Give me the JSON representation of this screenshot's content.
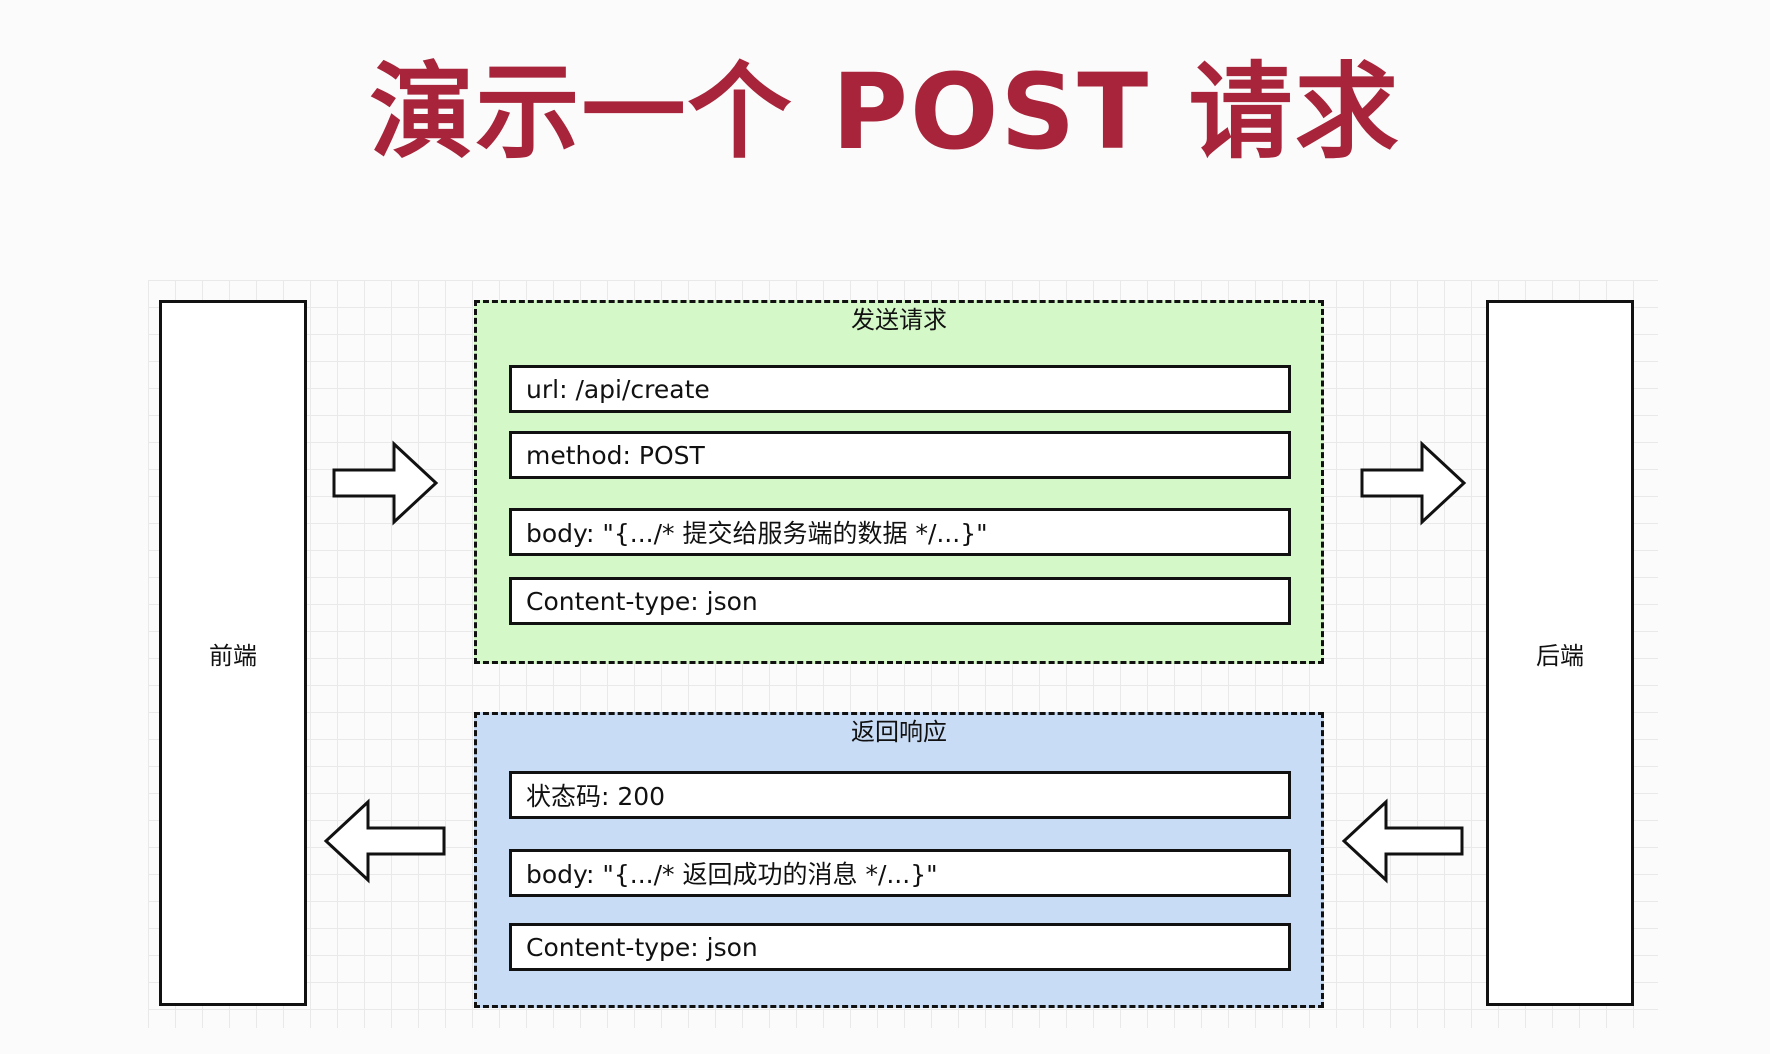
{
  "title": "演示一个 POST 请求",
  "frontend_label": "前端",
  "backend_label": "后端",
  "request": {
    "title": "发送请求",
    "fields": [
      "url: /api/create",
      "method: POST",
      "body: \"{.../* 提交给服务端的数据 */...}\"",
      "Content-type: json"
    ]
  },
  "response": {
    "title": "返回响应",
    "fields": [
      "状态码: 200",
      "body: \"{.../* 返回成功的消息 */...}\"",
      "Content-type: json"
    ]
  },
  "colors": {
    "title": "#a8243a",
    "request_bg": "#d5f8c8",
    "response_bg": "#c9dcf6"
  },
  "icons": [
    "arrow-right-icon",
    "arrow-left-icon"
  ]
}
